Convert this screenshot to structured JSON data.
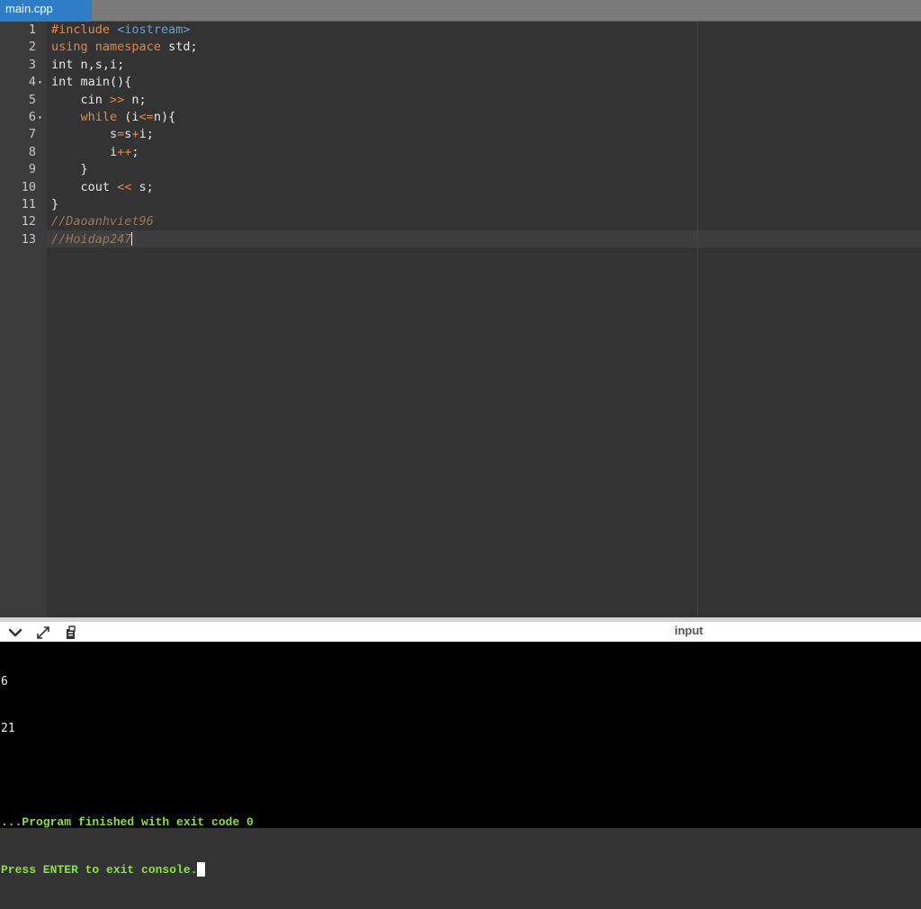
{
  "tab": {
    "label": "main.cpp"
  },
  "editor": {
    "lines": [
      {
        "n": "1",
        "text": "#include <iostream>"
      },
      {
        "n": "2",
        "text": "using namespace std;"
      },
      {
        "n": "3",
        "text": "int n,s,i;"
      },
      {
        "n": "4",
        "text": "int main(){"
      },
      {
        "n": "5",
        "text": "    cin >> n;"
      },
      {
        "n": "6",
        "text": "    while (i<=n){"
      },
      {
        "n": "7",
        "text": "        s=s+i;"
      },
      {
        "n": "8",
        "text": "        i++;"
      },
      {
        "n": "9",
        "text": "    }"
      },
      {
        "n": "10",
        "text": "    cout << s;"
      },
      {
        "n": "11",
        "text": "}"
      },
      {
        "n": "12",
        "text": "//Daoanhviet96"
      },
      {
        "n": "13",
        "text": "//Hoidap247"
      }
    ],
    "fold_markers": [
      "4",
      "6"
    ],
    "active_line": "13"
  },
  "console": {
    "input_label": "input",
    "output_lines": [
      "6",
      "21",
      "",
      "...Program finished with exit code 0",
      "Press ENTER to exit console."
    ],
    "icons": [
      "chevron-down-icon",
      "expand-icon",
      "copy-icon"
    ]
  },
  "colors": {
    "tab_active": "#2e7dc6",
    "keyword": "#e2874e",
    "include": "#6a9fd4",
    "comment": "#9a7a5a",
    "console_status": "#8ce04b"
  }
}
